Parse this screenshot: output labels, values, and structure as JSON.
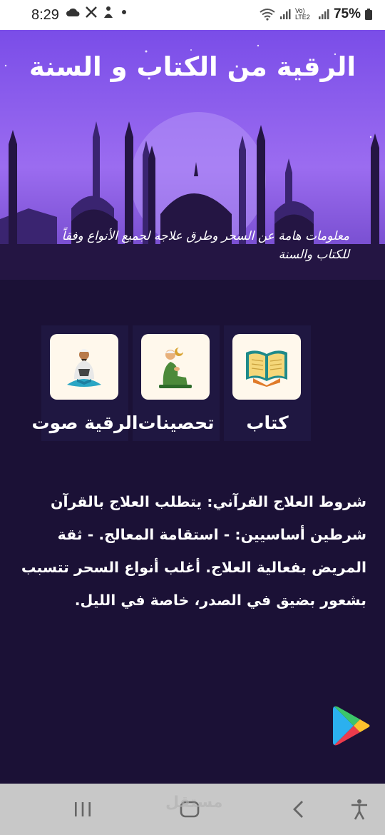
{
  "status_bar": {
    "time": "8:29",
    "battery": "75%",
    "network": "Vo) LTE2"
  },
  "header": {
    "title": "الرقية من الكتاب و السنة",
    "subtitle": "معلومات هامة عن السحر وطرق علاجه لجميع الأنواع وفقاً للكتاب والسنة"
  },
  "menu": {
    "items": [
      {
        "label": "كتاب",
        "icon": "quran-book-icon"
      },
      {
        "label": "تحصينات",
        "icon": "praying-man-icon"
      },
      {
        "label": "الرقية صوت",
        "icon": "reciting-man-icon"
      }
    ]
  },
  "content": {
    "text": "شروط العلاج القرآني: يتطلب العلاج بالقرآن شرطين أساسيين: - استقامة المعالج. - ثقة المريض بفعالية العلاج. أغلب أنواع السحر تتسبب بشعور بضيق في الصدر، خاصة في الليل."
  },
  "watermark": "مستقل",
  "colors": {
    "background": "#1b1136",
    "hero_top": "#7a4de8",
    "tile": "#fff8ec"
  }
}
